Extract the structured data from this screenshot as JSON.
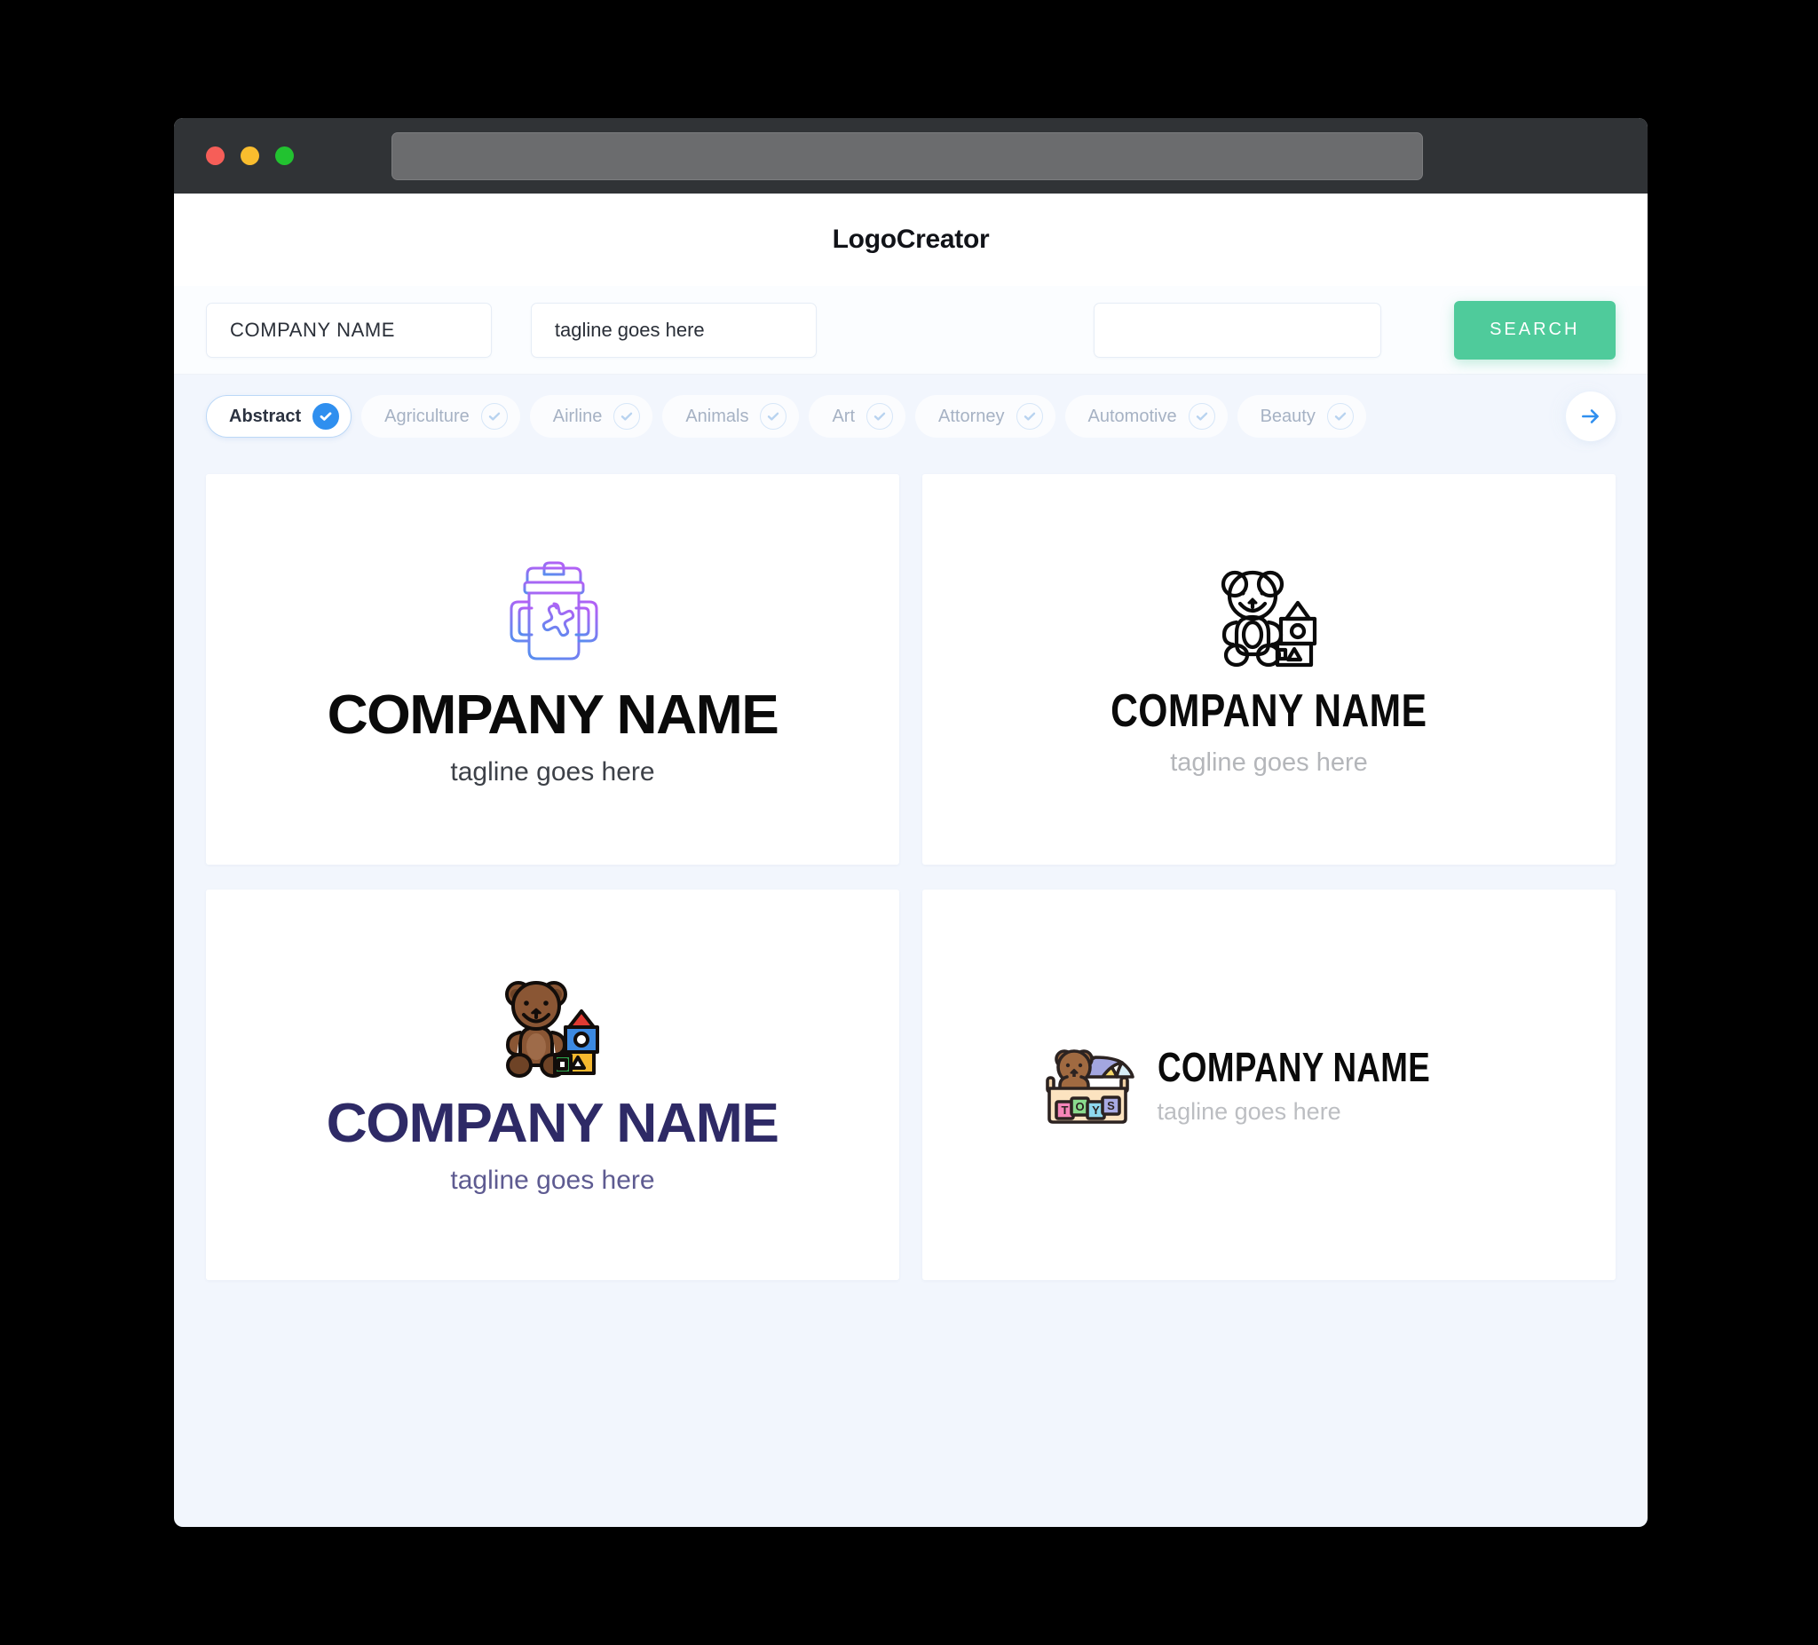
{
  "window": {
    "traffic_lights": [
      "close",
      "minimize",
      "maximize"
    ],
    "address_value": ""
  },
  "app": {
    "title": "LogoCreator"
  },
  "search": {
    "company_value": "COMPANY NAME",
    "tagline_value": "tagline goes here",
    "third_value": "",
    "button_label": "SEARCH",
    "button_color": "#4FCB9B"
  },
  "categories": {
    "accent_selected": "#2F8FEF",
    "items": [
      {
        "label": "Abstract",
        "selected": true
      },
      {
        "label": "Agriculture",
        "selected": false
      },
      {
        "label": "Airline",
        "selected": false
      },
      {
        "label": "Animals",
        "selected": false
      },
      {
        "label": "Art",
        "selected": false
      },
      {
        "label": "Attorney",
        "selected": false
      },
      {
        "label": "Automotive",
        "selected": false
      },
      {
        "label": "Beauty",
        "selected": false
      }
    ],
    "next_label": "next-page"
  },
  "results": [
    {
      "icon": "sippy-cup-icon",
      "layout": "stacked",
      "name": "COMPANY NAME",
      "tagline": "tagline goes here",
      "name_color": "#0A0A0A",
      "tagline_color": "#3D4148"
    },
    {
      "icon": "teddy-bear-blocks-outline-icon",
      "layout": "stacked",
      "name": "COMPANY NAME",
      "tagline": "tagline goes here",
      "name_color": "#0A0A0A",
      "tagline_color": "#B4B6BA"
    },
    {
      "icon": "teddy-bear-blocks-color-icon",
      "layout": "stacked",
      "name": "COMPANY NAME",
      "tagline": "tagline goes here",
      "name_color": "#2E2A66",
      "tagline_color": "#5E5B91"
    },
    {
      "icon": "toy-box-icon",
      "layout": "inline",
      "name": "COMPANY NAME",
      "tagline": "tagline goes here",
      "name_color": "#0A0A0A",
      "tagline_color": "#BCBEC2"
    }
  ]
}
